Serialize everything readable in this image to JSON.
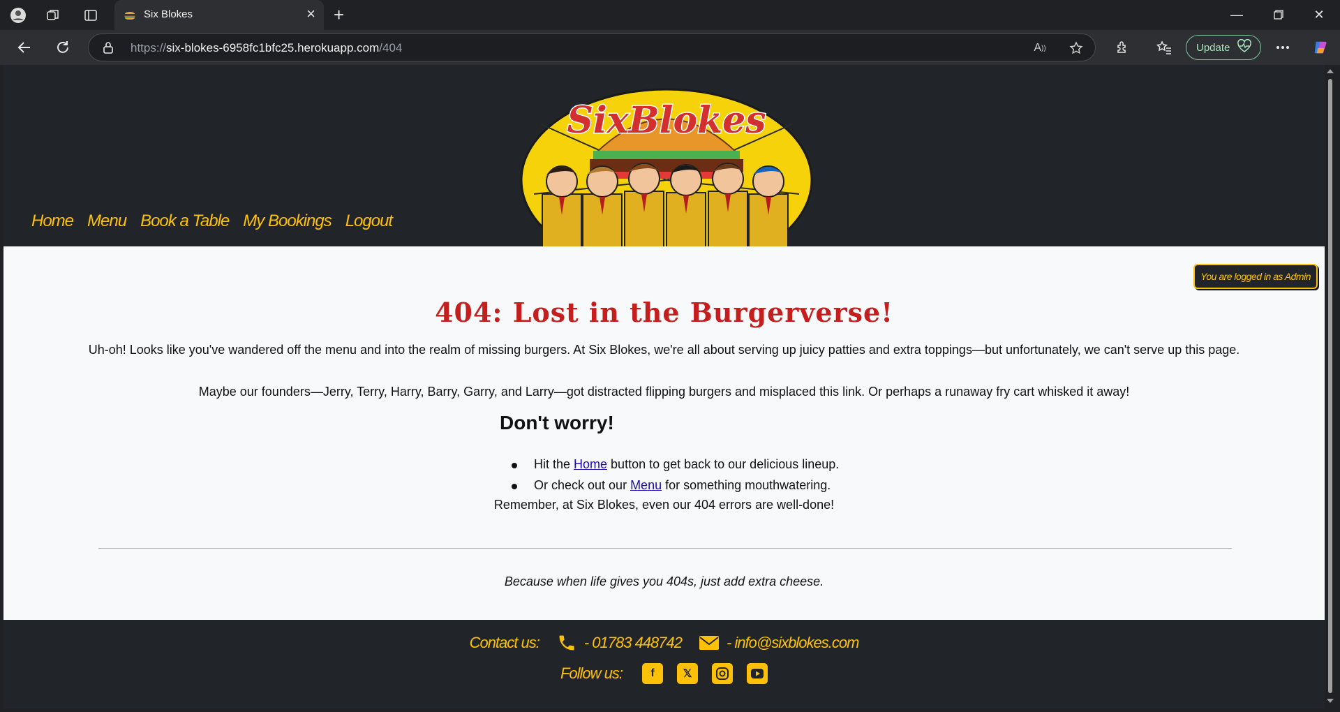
{
  "browser": {
    "tab_title": "Six Blokes",
    "url_scheme": "https://",
    "url_host": "six-blokes-6958fc1bfc25.herokuapp.com",
    "url_path": "/404",
    "update_label": "Update"
  },
  "site": {
    "logo_text": "SixBlokes",
    "nav": [
      "Home",
      "Menu",
      "Book a Table",
      "My Bookings",
      "Logout"
    ],
    "login_status": "You are logged in as Admin"
  },
  "content": {
    "title": "404: Lost in the Burgerverse!",
    "para1": "Uh-oh! Looks like you've wandered off the menu and into the realm of missing burgers. At Six Blokes, we're all about serving up juicy patties and extra toppings—but unfortunately, we can't serve up this page.",
    "para2": "Maybe our founders—Jerry, Terry, Harry, Barry, Garry, and Larry—got distracted flipping burgers and misplaced this link. Or perhaps a runaway fry cart whisked it away!",
    "dont_worry": "Don't worry!",
    "bullet1_pre": "Hit the ",
    "bullet1_link": "Home",
    "bullet1_post": " button to get back to our delicious lineup.",
    "bullet2_pre": "Or check out our ",
    "bullet2_link": "Menu",
    "bullet2_post": " for something mouthwatering.",
    "remember": "Remember, at Six Blokes, even our 404 errors are well-done!",
    "tagline": "Because when life gives you 404s, just add extra cheese."
  },
  "footer": {
    "contact_label": "Contact us:",
    "phone": "- 01783 448742",
    "email": "- info@sixblokes.com",
    "follow_label": "Follow us:"
  },
  "colors": {
    "accent": "#ffc107",
    "header_bg": "#212529",
    "title_red": "#c41e1e"
  }
}
